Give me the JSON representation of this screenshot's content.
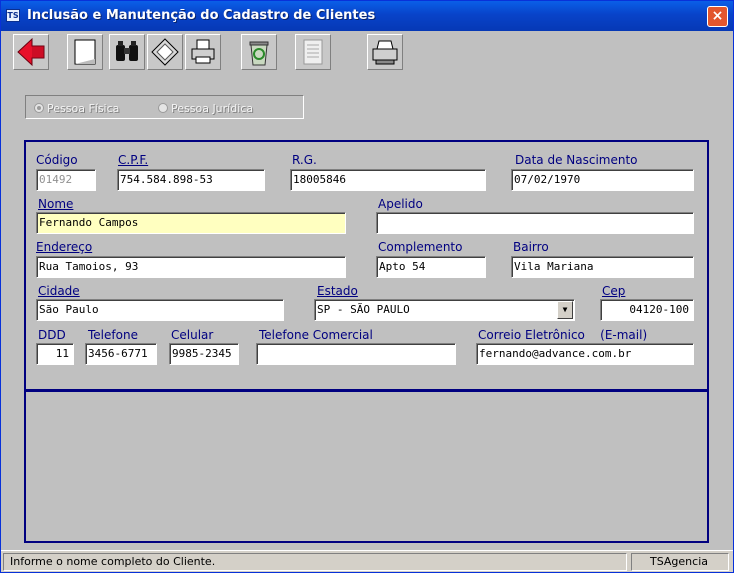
{
  "window": {
    "title": "Inclusão e Manutenção do Cadastro de Clientes",
    "app_icon": "TS",
    "close": "×"
  },
  "toolbar": {
    "buttons": [
      {
        "name": "back-arrow-icon",
        "color": "#e8102a"
      },
      {
        "name": "new-document-icon"
      },
      {
        "name": "binoculars-icon"
      },
      {
        "name": "diskette-save-icon"
      },
      {
        "name": "print-preview-icon"
      },
      {
        "name": "recycle-bin-icon"
      },
      {
        "name": "report-list-icon"
      },
      {
        "name": "printer-icon"
      }
    ]
  },
  "tipo_pessoa": {
    "fisica": "Pessoa Física",
    "juridica": "Pessoa Jurídica",
    "selected": "fisica"
  },
  "form": {
    "codigo": {
      "label": "Código",
      "value": "01492"
    },
    "cpf": {
      "label": "C.P.F.",
      "value": "754.584.898-53"
    },
    "rg": {
      "label": "R.G.",
      "value": "18005846"
    },
    "nascimento": {
      "label": "Data de Nascimento",
      "value": "07/02/1970"
    },
    "nome": {
      "label": "Nome",
      "value": "Fernando Campos"
    },
    "apelido": {
      "label": "Apelido",
      "value": ""
    },
    "endereco": {
      "label": "Endereço",
      "value": "Rua Tamoios, 93"
    },
    "complemento": {
      "label": "Complemento",
      "value": "Apto 54"
    },
    "bairro": {
      "label": "Bairro",
      "value": "Vila Mariana"
    },
    "cidade": {
      "label": "Cidade",
      "value": "São Paulo"
    },
    "estado": {
      "label": "Estado",
      "value": "SP - SÃO PAULO"
    },
    "cep": {
      "label": "Cep",
      "value": "04120-100"
    },
    "ddd": {
      "label": "DDD",
      "value": "11"
    },
    "telefone": {
      "label": "Telefone",
      "value": "3456-6771"
    },
    "celular": {
      "label": "Celular",
      "value": "9985-2345"
    },
    "tel_comercial": {
      "label": "Telefone Comercial",
      "value": ""
    },
    "email": {
      "label": "Correio Eletrônico    (E-mail)",
      "value": "fernando@advance.com.br"
    }
  },
  "status": {
    "message": "Informe o nome completo do Cliente.",
    "app": "TSAgencia"
  }
}
